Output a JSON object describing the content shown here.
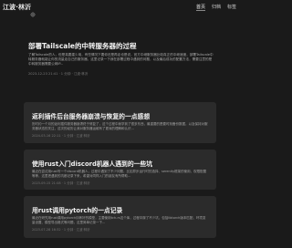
{
  "site": {
    "title": "江波·林沂",
    "theme_icon": "sun-icon"
  },
  "nav": {
    "items": [
      {
        "label": "首页",
        "active": true
      },
      {
        "label": "归档",
        "active": false
      },
      {
        "label": "标签",
        "active": false
      }
    ]
  },
  "hero_post": {
    "title": "部署Tailscale的中转服务器的过程",
    "summary": "了解Tailscale的人，但是真要建少用，有些情况下要你还是再走也是说，官方中继服务器比较真正的中继速度，部署Tailscale中转服务器就能让你的流量走自己的服务器，这里记录一下我在部署过程中遇到的问题，以及最后成功的配置方法，需要注意的是中转服务器需要公网IP...",
    "meta": "2023-12-23 21:41 · 1 分钟 · 江波·林沂"
  },
  "posts": [
    {
      "title": "返利插件后台服务器崩溃与恢复的一点感想",
      "summary": "历时约一个月的返利插件服务器崩溃终于修复了，这个过程中我学到了很多东西，最重要的是要时刻备份数据，以及保持对服务器状态的关注，这次的经历让我对服务器运维有了更深的理解和认识...",
      "meta": "2024-03-16 22:11 · 1 分钟 · 江波·林沂"
    },
    {
      "title": "使用rust入门discord机器人遇到的一些坑",
      "summary": "最近在尝试用rust写一个discord机器人，过程中遇到了不少问题，比如异步运行时的选择、serenity框架的使用、权限配置等等，这里把遇到的坑都记录下来，希望对同样入门的朋友有所帮助...",
      "meta": "2023-09-15 21:08 · 1 分钟 · 江波·林沂"
    },
    {
      "title": "用rust调用pytorch的一点记录",
      "summary": "最近在研究用rust调用pytorch训练好的模型，主要使用tch-rs这个库，过程中踩了不少坑，包括libtorch版本匹配、环境变量设置、模型导出格式等问题，这里简单记录一下...",
      "meta": "2023-07-28 16:32 · 1 分钟 · 江波·林沂"
    }
  ]
}
